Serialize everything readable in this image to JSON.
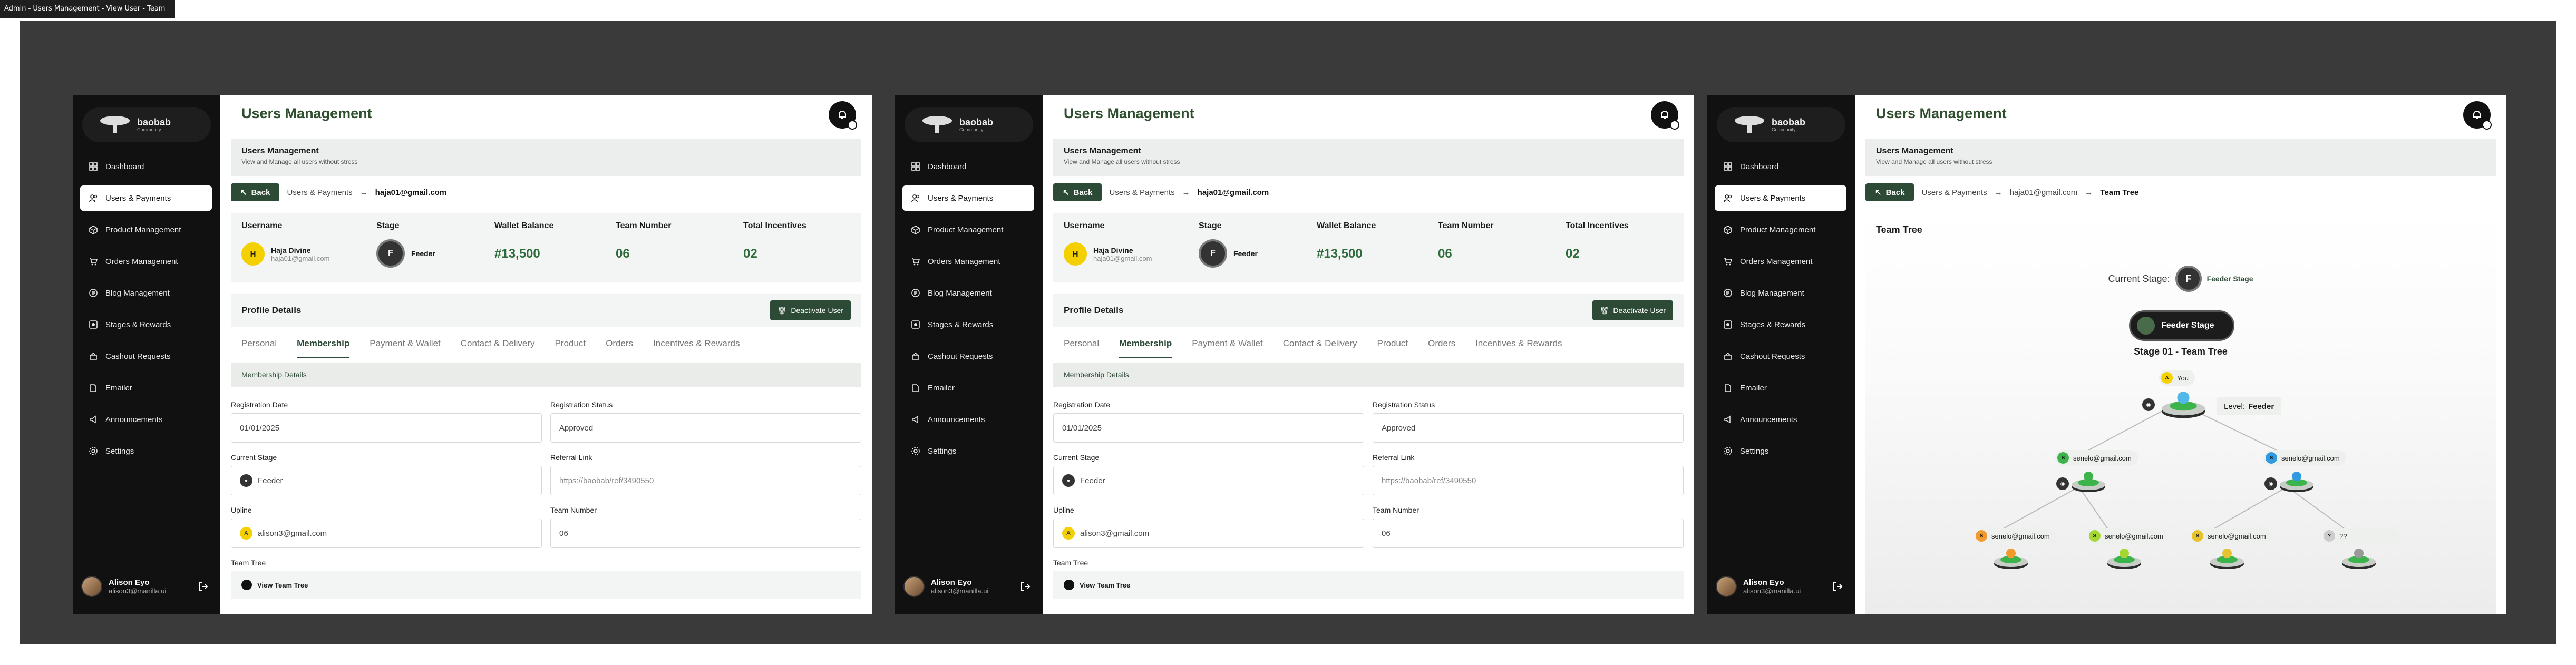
{
  "window_tag": "Admin - Users Management - View User - Team Tree",
  "brand": {
    "name": "baobab",
    "sub": "Community"
  },
  "nav": [
    {
      "label": "Dashboard",
      "icon": "grid-icon"
    },
    {
      "label": "Users & Payments",
      "icon": "users-icon"
    },
    {
      "label": "Product Management",
      "icon": "box-icon"
    },
    {
      "label": "Orders Management",
      "icon": "cart-icon"
    },
    {
      "label": "Blog Management",
      "icon": "blog-icon"
    },
    {
      "label": "Stages & Rewards",
      "icon": "stage-icon"
    },
    {
      "label": "Cashout Requests",
      "icon": "wallet-icon"
    },
    {
      "label": "Emailer",
      "icon": "mail-icon"
    },
    {
      "label": "Announcements",
      "icon": "megaphone-icon"
    },
    {
      "label": "Settings",
      "icon": "gear-icon"
    }
  ],
  "admin": {
    "name": "Alison Eyo",
    "email": "alison3@manilla.ui"
  },
  "page_title": "Users Management",
  "header_card": {
    "title": "Users Management",
    "subtitle": "View and Manage all users without stress"
  },
  "breadcrumb": {
    "back": "Back",
    "section": "Users & Payments",
    "user": "hajа01@gmail.com",
    "tree": "Team Tree"
  },
  "stats": {
    "username_label": "Username",
    "stage_label": "Stage",
    "wallet_label": "Wallet Balance",
    "team_label": "Team Number",
    "incentives_label": "Total Incentives",
    "user_initial": "H",
    "user_name": "Hajа Divine",
    "user_email": "hajа01@gmail.com",
    "stage_letter": "F",
    "stage": "Feeder",
    "wallet": "#13,500",
    "team": "06",
    "incentives": "02"
  },
  "profile": {
    "title": "Profile Details",
    "deactivate": "Deactivate User"
  },
  "tabs": [
    "Personal",
    "Membership",
    "Payment & Wallet",
    "Contact & Delivery",
    "Product",
    "Orders",
    "Incentives & Rewards"
  ],
  "membership": {
    "section": "Membership Details",
    "reg_date_label": "Registration Date",
    "reg_date": "01/01/2025",
    "reg_status_label": "Registration Status",
    "reg_status": "Approved",
    "cur_stage_label": "Current Stage",
    "cur_stage": "Feeder",
    "ref_label": "Referral Link",
    "ref": "https://baobab/ref/3490550",
    "upline_label": "Upline",
    "upline": "alison3@gmail.com",
    "upline_initial": "A",
    "team_no_label": "Team Number",
    "team_no": "06",
    "team_tree_label": "Team Tree",
    "view_tree": "View Team Tree"
  },
  "tree": {
    "title": "Team Tree",
    "current_stage_label": "Current Stage:",
    "current_stage": "Feeder Stage",
    "pill": "Feeder Stage",
    "heading": "Stage 01 - Team Tree",
    "you": "You",
    "level_label": "Level:",
    "level": "Feeder",
    "node_email": "senelo@gmail.com",
    "empty": "??"
  }
}
